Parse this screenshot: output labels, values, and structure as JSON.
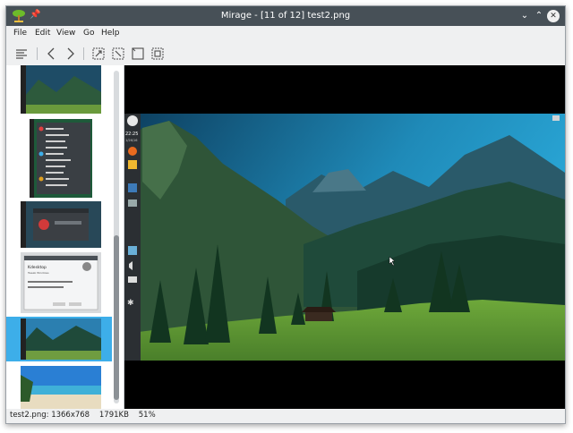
{
  "window": {
    "title": "Mirage - [11 of 12] test2.png"
  },
  "menu": [
    "File",
    "Edit",
    "View",
    "Go",
    "Help"
  ],
  "toolbar": {
    "buttons": [
      "list-view",
      "previous",
      "next",
      "fit-to-window",
      "zoom-in",
      "zoom-out",
      "original-size"
    ]
  },
  "desktop": {
    "clock_time": "22:25",
    "clock_date": "1/26/16"
  },
  "thumbnail_sample": {
    "dialog_title": "Kdesktop",
    "dialog_subtitle": "Tweak Windows"
  },
  "status": {
    "filename": "test2.png:",
    "dimensions": "1366x768",
    "size": "1791KB",
    "zoom": "51%"
  },
  "colors": {
    "selection": "#3daee9",
    "titlebar": "#475057"
  }
}
